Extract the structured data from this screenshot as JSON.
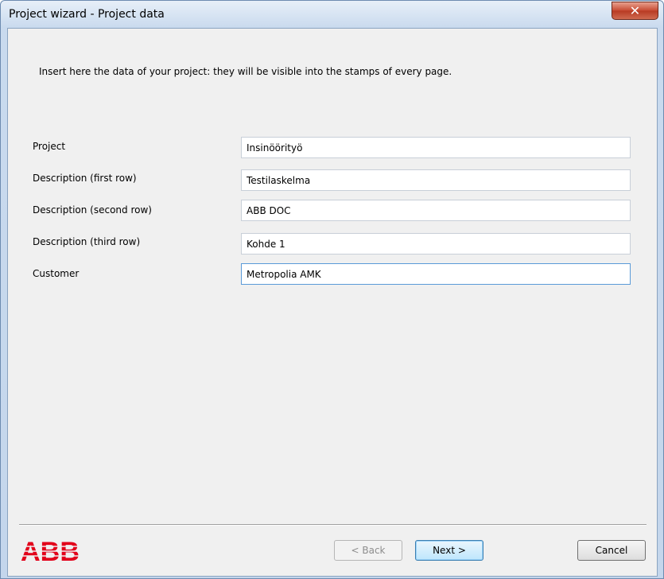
{
  "window": {
    "title": "Project wizard - Project data",
    "close_symbol": "✕"
  },
  "intro_text": "Insert here the data of your project: they will be visible into the stamps of every page.",
  "fields": [
    {
      "label": "Project",
      "value": "Insinöörityö"
    },
    {
      "label": "Description (first row)",
      "value": "Testilaskelma"
    },
    {
      "label": "Description (second row)",
      "value": "ABB DOC"
    },
    {
      "label": "Description (third row)",
      "value": "Kohde 1"
    },
    {
      "label": "Customer",
      "value": "Metropolia AMK"
    }
  ],
  "logo": {
    "text": "ABB",
    "color": "#e2001a"
  },
  "buttons": {
    "back": "< Back",
    "next": "Next >",
    "cancel": "Cancel"
  }
}
